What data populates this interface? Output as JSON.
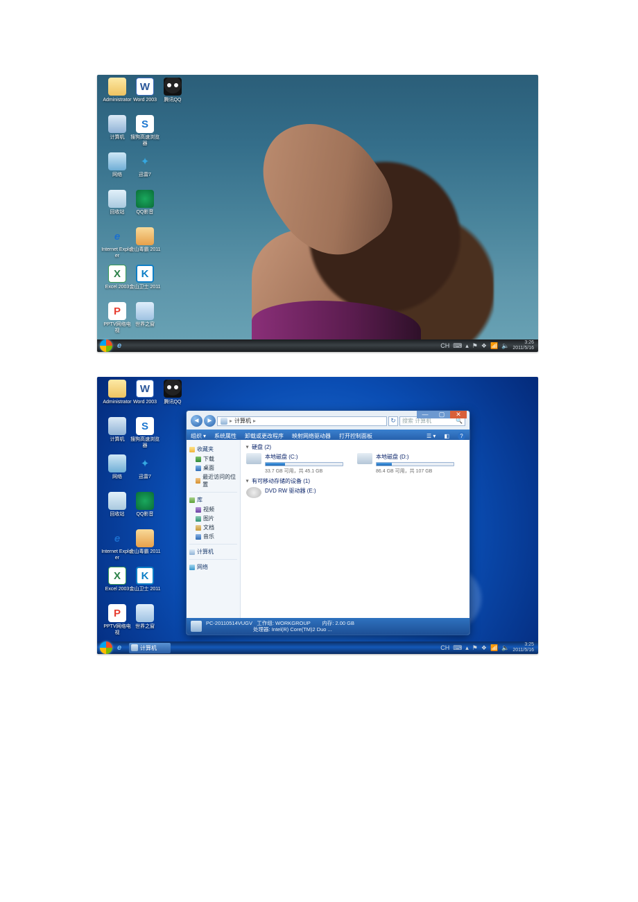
{
  "screenshot1": {
    "icons": [
      {
        "row": 0,
        "col": 0,
        "label": "Administrator",
        "cls": "ic-folder"
      },
      {
        "row": 0,
        "col": 1,
        "label": "Word 2003",
        "cls": "ic-word",
        "glyph": "W"
      },
      {
        "row": 0,
        "col": 2,
        "label": "腾讯QQ",
        "cls": "ic-qq"
      },
      {
        "row": 1,
        "col": 0,
        "label": "计算机",
        "cls": "ic-pc"
      },
      {
        "row": 1,
        "col": 1,
        "label": "搜狗高速浏览器",
        "cls": "ic-sogou",
        "glyph": "S"
      },
      {
        "row": 2,
        "col": 0,
        "label": "网络",
        "cls": "ic-net"
      },
      {
        "row": 2,
        "col": 1,
        "label": "迅雷7",
        "cls": "ic-xl",
        "glyph": "✦"
      },
      {
        "row": 3,
        "col": 0,
        "label": "回收站",
        "cls": "ic-bin"
      },
      {
        "row": 3,
        "col": 1,
        "label": "QQ影音",
        "cls": "ic-qqm"
      },
      {
        "row": 4,
        "col": 0,
        "label": "Internet Explorer",
        "cls": "ic-ie",
        "glyph": "e"
      },
      {
        "row": 4,
        "col": 1,
        "label": "金山毒霸 2011",
        "cls": "ic-js"
      },
      {
        "row": 5,
        "col": 0,
        "label": "Excel 2003",
        "cls": "ic-xl2",
        "glyph": "X"
      },
      {
        "row": 5,
        "col": 1,
        "label": "金山卫士 2011",
        "cls": "ic-kb",
        "glyph": "K"
      },
      {
        "row": 6,
        "col": 0,
        "label": "PPTV网络电视",
        "cls": "ic-pps",
        "glyph": "P"
      },
      {
        "row": 6,
        "col": 1,
        "label": "世界之窗",
        "cls": "ic-ww"
      }
    ],
    "tray": {
      "lang": "CH",
      "time": "3:26",
      "date": "2011/5/16"
    }
  },
  "screenshot2": {
    "icons": [
      {
        "row": 0,
        "col": 0,
        "label": "Administrator",
        "cls": "ic-folder"
      },
      {
        "row": 0,
        "col": 1,
        "label": "Word 2003",
        "cls": "ic-word",
        "glyph": "W"
      },
      {
        "row": 0,
        "col": 2,
        "label": "腾讯QQ",
        "cls": "ic-qq"
      },
      {
        "row": 1,
        "col": 0,
        "label": "计算机",
        "cls": "ic-pc"
      },
      {
        "row": 1,
        "col": 1,
        "label": "搜狗高速浏览器",
        "cls": "ic-sogou",
        "glyph": "S"
      },
      {
        "row": 2,
        "col": 0,
        "label": "网络",
        "cls": "ic-net"
      },
      {
        "row": 2,
        "col": 1,
        "label": "迅雷7",
        "cls": "ic-xl",
        "glyph": "✦"
      },
      {
        "row": 3,
        "col": 0,
        "label": "回收站",
        "cls": "ic-bin"
      },
      {
        "row": 3,
        "col": 1,
        "label": "QQ影音",
        "cls": "ic-qqm"
      },
      {
        "row": 4,
        "col": 0,
        "label": "Internet Explorer",
        "cls": "ic-ie",
        "glyph": "e"
      },
      {
        "row": 4,
        "col": 1,
        "label": "金山毒霸 2011",
        "cls": "ic-js"
      },
      {
        "row": 5,
        "col": 0,
        "label": "Excel 2003",
        "cls": "ic-xl2",
        "glyph": "X"
      },
      {
        "row": 5,
        "col": 1,
        "label": "金山卫士 2011",
        "cls": "ic-kb",
        "glyph": "K"
      },
      {
        "row": 6,
        "col": 0,
        "label": "PPTV网络电视",
        "cls": "ic-pps",
        "glyph": "P"
      },
      {
        "row": 6,
        "col": 1,
        "label": "世界之窗",
        "cls": "ic-ww"
      }
    ],
    "taskbar_task": "计算机",
    "tray": {
      "lang": "CH",
      "time": "3:25",
      "date": "2011/5/16"
    },
    "explorer": {
      "breadcrumb_root": "计算机",
      "search_placeholder": "搜索 计算机",
      "toolbar": [
        "组织",
        "系统属性",
        "卸载或更改程序",
        "映射网络驱动器",
        "打开控制面板"
      ],
      "nav": {
        "favorites": "收藏夹",
        "fav_items": [
          "下载",
          "桌面",
          "最近访问的位置"
        ],
        "libraries": "库",
        "lib_items": [
          "视频",
          "图片",
          "文档",
          "音乐"
        ],
        "computer": "计算机",
        "network": "网络"
      },
      "group_hdd": "硬盘 (2)",
      "drives": [
        {
          "name": "本地磁盘 (C:)",
          "free": "33.7 GB 可用，共 45.1 GB",
          "fill": 25
        },
        {
          "name": "本地磁盘 (D:)",
          "free": "86.4 GB 可用，共 107 GB",
          "fill": 20
        }
      ],
      "group_rem": "有可移动存储的设备 (1)",
      "removable": {
        "name": "DVD RW 驱动器 (E:)"
      },
      "status": {
        "name": "PC-20110514VUGV",
        "workgroup_lbl": "工作组:",
        "workgroup": "WORKGROUP",
        "mem_lbl": "内存:",
        "mem": "2.00 GB",
        "cpu_lbl": "处理器:",
        "cpu": "Intel(R) Core(TM)2 Duo ..."
      }
    }
  }
}
